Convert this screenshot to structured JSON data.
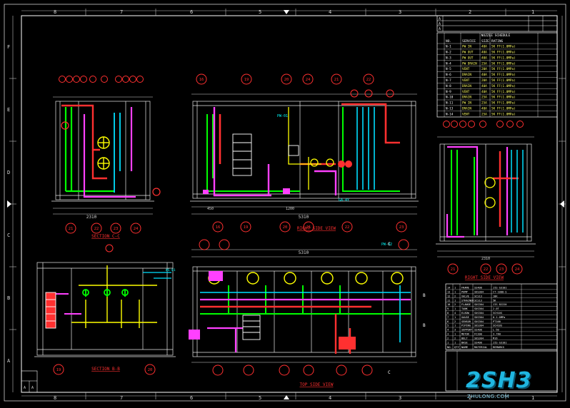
{
  "drawing": {
    "col_markers_top": [
      "8",
      "7",
      "6",
      "5",
      "4",
      "3",
      "2",
      "1"
    ],
    "col_markers_bottom": [
      "8",
      "7",
      "6",
      "5",
      "4",
      "3",
      "2",
      "1"
    ],
    "row_markers": [
      "F",
      "E",
      "D",
      "C",
      "B",
      "A"
    ],
    "view_titles": {
      "section_c": "SECTION C-C",
      "right_side": "RIGHT SIDE VIEW",
      "right_side_2": "RIGHT SIDE VIEW",
      "section_b": "SECTION B-B",
      "top_side": "TOP SIDE VIEW"
    },
    "dims": {
      "sec_c_total": "2310",
      "front_total": "5310",
      "top_total": "5310",
      "front_left": "450",
      "front_mid": "1200",
      "side_total": "2310"
    },
    "section_tags": [
      "C",
      "C",
      "B",
      "B"
    ],
    "bubbles_row_a": [
      "21",
      "22",
      "23",
      "24"
    ],
    "bubbles_row_b": [
      "16",
      "19",
      "20",
      "24",
      "21",
      "22"
    ],
    "bubbles_row_c": [
      "16",
      "19",
      "20",
      "21",
      "22",
      "23"
    ],
    "bubbles_row_d": [
      "21",
      "22",
      "23",
      "24"
    ],
    "bubbles_row_e": [
      "19",
      "20"
    ],
    "pipe_labels": [
      "PW-01",
      "GA-4Y",
      "WS-01",
      "PW-02"
    ]
  },
  "nozzle_table": {
    "title": "NOZZLE SCHEDULE",
    "headers": [
      "NO.",
      "SERVICE",
      "SIZE",
      "RATING"
    ],
    "rows": [
      [
        "N-1",
        "PW IN",
        "40A",
        "5K FF(1.0MPa)"
      ],
      [
        "N-2",
        "PW OUT",
        "40A",
        "5K FF(1.0MPa)"
      ],
      [
        "N-3",
        "PW OUT",
        "40A",
        "5K FF(1.0MPa)"
      ],
      [
        "N-4",
        "PW DRAIN",
        "25A",
        "5K FF(1.0MPa)"
      ],
      [
        "N-5",
        "VENT",
        "20A",
        "5K FF(1.0MPa)"
      ],
      [
        "N-6",
        "DRAIN",
        "40A",
        "5K FF(1.0MPa)"
      ],
      [
        "N-7",
        "VENT",
        "20A",
        "5K FF(1.0MPa)"
      ],
      [
        "N-8",
        "DRAIN",
        "40A",
        "5K FF(1.0MPa)"
      ],
      [
        "N-9",
        "VENT",
        "40A",
        "5K FF(1.0MPa)"
      ],
      [
        "N-10",
        "DRAIN",
        "25A",
        "5K FF(1.0MPa)"
      ],
      [
        "N-11",
        "PW IN",
        "25A",
        "5K FF(1.0MPa)"
      ],
      [
        "N-13",
        "DRAIN",
        "40A",
        "5K FF(1.0MPa)"
      ],
      [
        "N-14",
        "VENT",
        "25A",
        "5K FF(1.0MPa)"
      ]
    ]
  },
  "revision_block": {
    "rows": [
      "A",
      "A",
      "A"
    ]
  },
  "parts_list": {
    "rows": [
      [
        "14",
        "1",
        "FRAME",
        "SS400",
        "JIS G3101"
      ],
      [
        "13",
        "1",
        "PUMP",
        "SUS304",
        "CT-1000-S"
      ],
      [
        "12",
        "2",
        "VALVE",
        "SCS13",
        "10K"
      ],
      [
        "11",
        "1",
        "STRAINER",
        "SCS13",
        "5K"
      ],
      [
        "10",
        "2",
        "FLANGE",
        "SUS304",
        "JIS B2220"
      ],
      [
        "9",
        "1",
        "TANK",
        "SUS304",
        "2.0T"
      ],
      [
        "8",
        "4",
        "ELBOW",
        "SUS304",
        "SCH10S"
      ],
      [
        "7",
        "1",
        "GAUGE",
        "SUS304",
        "0-1.0MPa"
      ],
      [
        "6",
        "2",
        "SENSOR",
        "SUS304",
        "PT100"
      ],
      [
        "5",
        "1",
        "PIPING",
        "SUS304",
        "SCH10S"
      ],
      [
        "4",
        "3",
        "SUPPORT",
        "SS400",
        "L-50"
      ],
      [
        "3",
        "1",
        "MOTOR",
        "FC200",
        "3.7kW"
      ],
      [
        "2",
        "2",
        "BOLT",
        "SUS304",
        "M16"
      ],
      [
        "1",
        "1",
        "BASE",
        "SS400",
        "JIS G3101"
      ]
    ],
    "footer": [
      "NO.",
      "QTY",
      "NAME",
      "MATERIAL",
      "REMARKS"
    ]
  },
  "title_block": {
    "left_a": "A",
    "left_b": "A"
  },
  "watermark": {
    "logo": "2SH3",
    "sub": "ZHULONG.COM"
  }
}
